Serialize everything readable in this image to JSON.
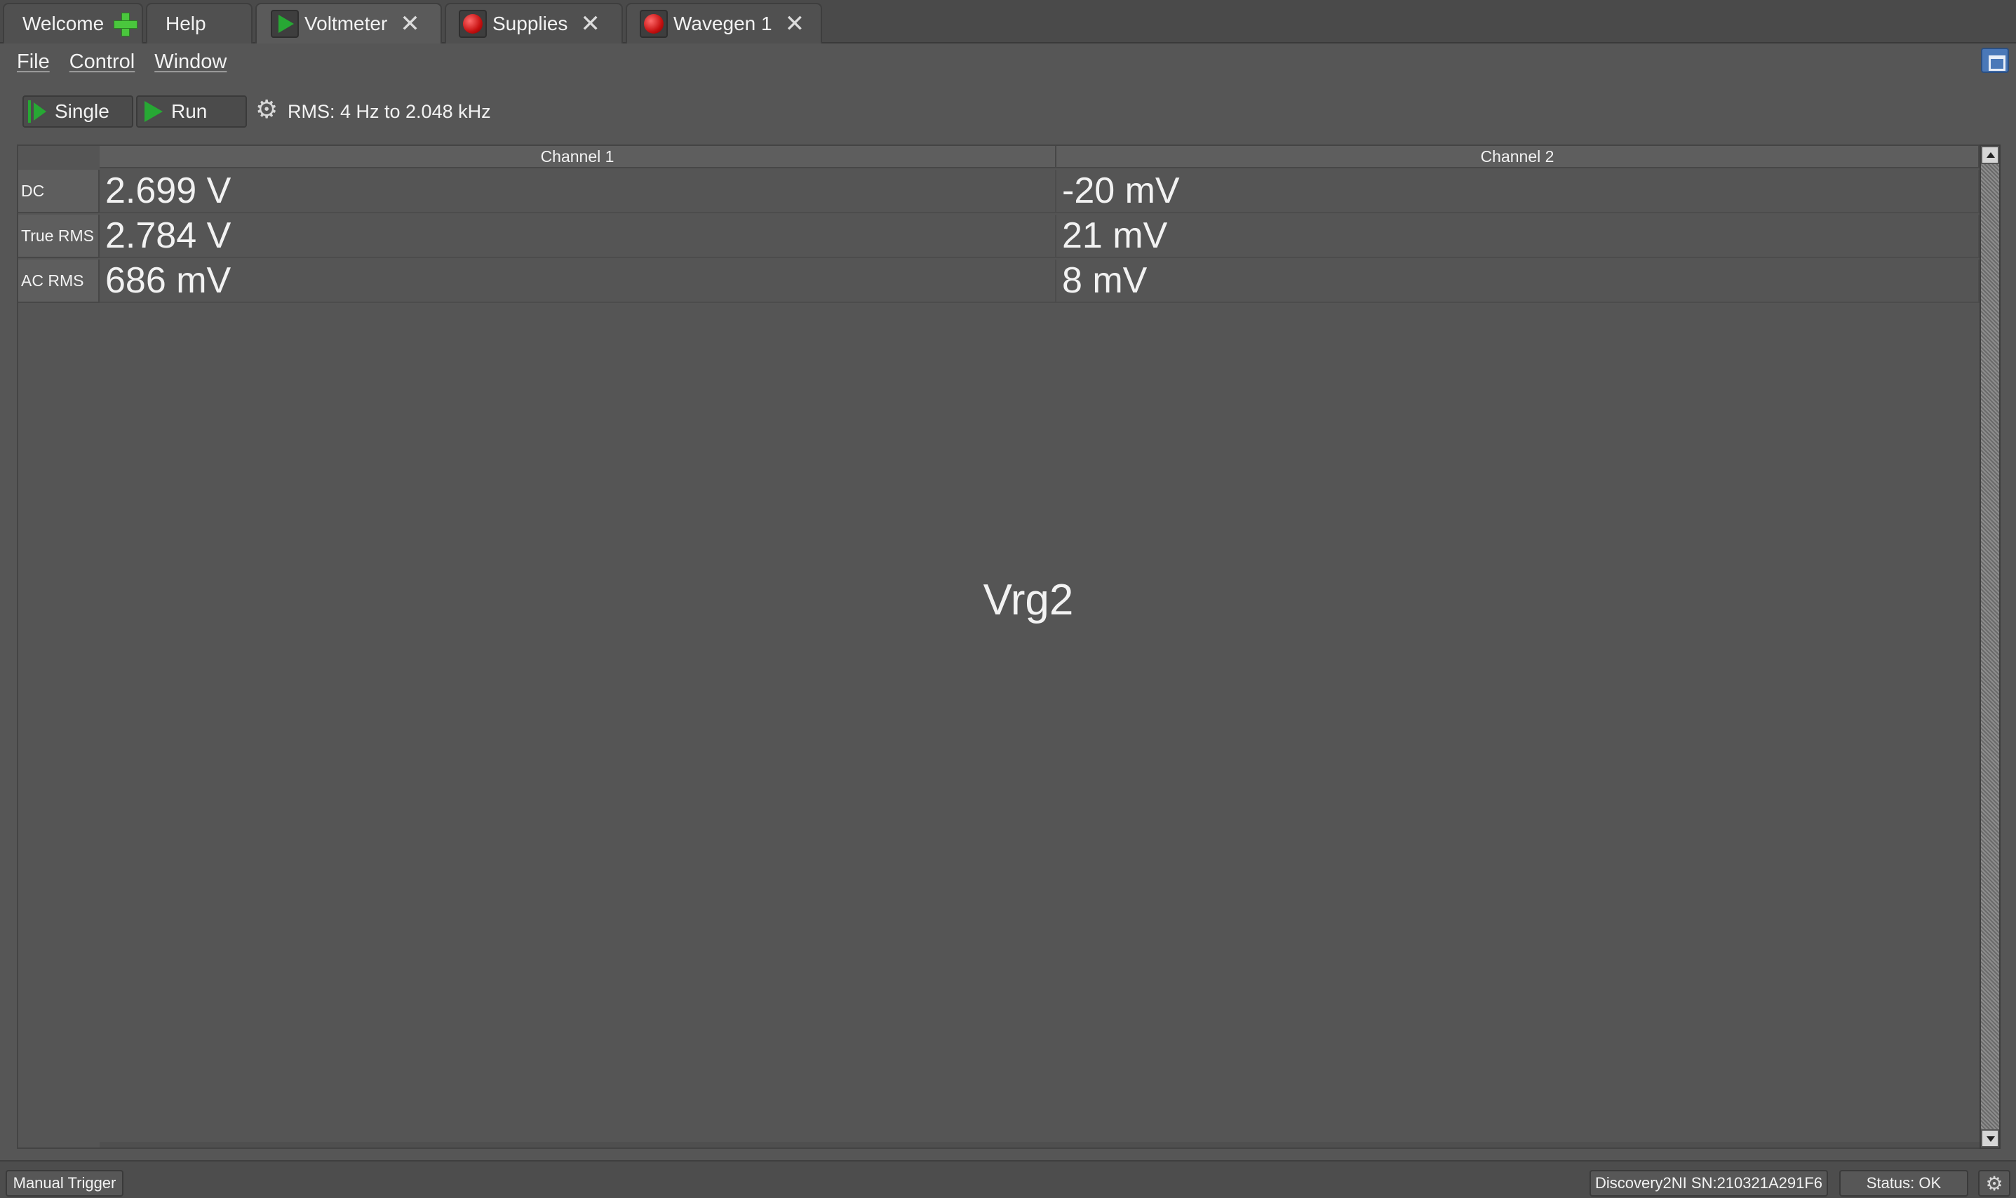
{
  "tabs": [
    {
      "label": "Welcome",
      "icon": "plus-icon"
    },
    {
      "label": "Help"
    },
    {
      "label": "Voltmeter",
      "icon": "play-icon",
      "active": true
    },
    {
      "label": "Supplies",
      "icon": "record-icon"
    },
    {
      "label": "Wavegen 1",
      "icon": "record-icon"
    }
  ],
  "menu": {
    "file": "File",
    "control": "Control",
    "window": "Window"
  },
  "toolbar": {
    "single_label": "Single",
    "run_label": "Run",
    "rms_text": "RMS: 4 Hz to 2.048 kHz"
  },
  "table": {
    "columns": [
      "Channel 1",
      "Channel 2"
    ],
    "rows": [
      {
        "label": "DC",
        "ch1": "2.699 V",
        "ch2": "-20 mV"
      },
      {
        "label": "True RMS",
        "ch1": "2.784 V",
        "ch2": "21 mV"
      },
      {
        "label": "AC RMS",
        "ch1": "686 mV",
        "ch2": "8 mV"
      }
    ]
  },
  "center_label": "Vrg2",
  "status": {
    "manual_trigger": "Manual Trigger",
    "device": "Discovery2NI SN:210321A291F6",
    "status": "Status: OK"
  },
  "colors": {
    "background": "#565656",
    "play_green": "#27a834",
    "record_red": "#c61010",
    "plus_green": "#4ac73d"
  }
}
